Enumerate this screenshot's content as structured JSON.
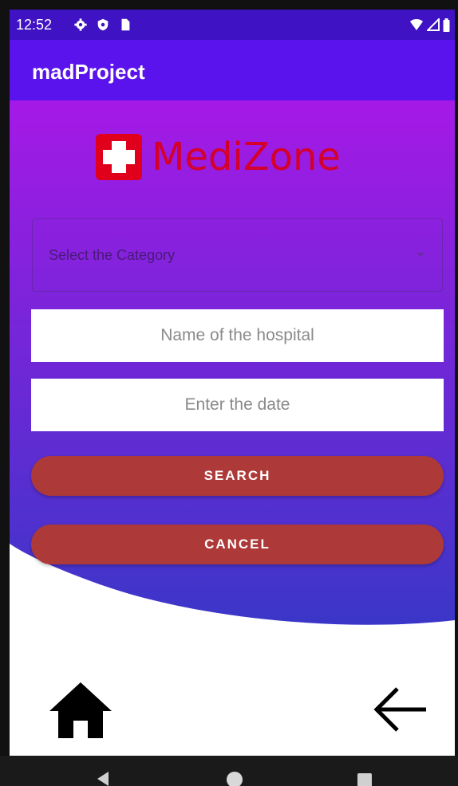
{
  "status_bar": {
    "time": "12:52",
    "left_icons": [
      "settings-icon",
      "shield-icon",
      "sim-card-icon"
    ],
    "right_icons": [
      "wifi-icon",
      "signal-icon",
      "battery-icon"
    ]
  },
  "app_bar": {
    "title": "madProject"
  },
  "logo": {
    "brand_name": "MediZone",
    "icon": "medical-cross-icon"
  },
  "form": {
    "category_select": {
      "value": "Select the Category"
    },
    "hospital_input": {
      "placeholder": "Name of the hospital",
      "value": ""
    },
    "date_input": {
      "placeholder": "Enter the date",
      "value": ""
    },
    "search_label": "SEARCH",
    "cancel_label": "CANCEL"
  },
  "bottom_actions": {
    "home_icon": "home-icon",
    "back_icon": "arrow-left-icon"
  },
  "nav_bar": {
    "icons": [
      "nav-back-icon",
      "nav-home-icon",
      "nav-recents-icon"
    ]
  },
  "colors": {
    "status_bar": "#3f12c4",
    "app_bar": "#5a13ec",
    "gradient_top": "#a519e6",
    "gradient_bottom": "#3b36c8",
    "button": "#ae3939",
    "logo_red": "#d4002a"
  }
}
